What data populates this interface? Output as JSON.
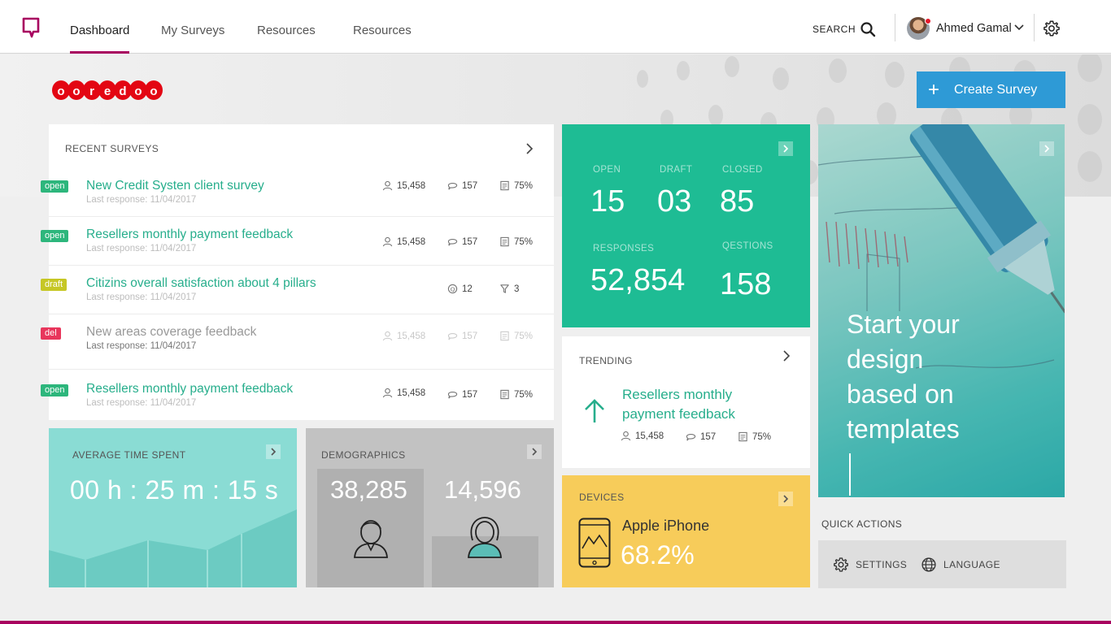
{
  "nav": {
    "tabs": [
      {
        "label": "Dashboard"
      },
      {
        "label": "My Surveys"
      },
      {
        "label": "Resources"
      },
      {
        "label": "Resources"
      }
    ],
    "search_label": "SEARCH",
    "user_name": "Ahmed Gamal"
  },
  "brand": {
    "letters": [
      "o",
      "o",
      "r",
      "e",
      "d",
      "o",
      "o"
    ]
  },
  "create_button": {
    "label": "Create Survey"
  },
  "recent": {
    "title": "RECENT SURVEYS",
    "rows": [
      {
        "status": "open",
        "title": "New Credit Systen client survey",
        "sub": "Last response: 11/04/2017",
        "users": "15,458",
        "comments": "157",
        "pct": "75%"
      },
      {
        "status": "open",
        "title": "Resellers monthly payment feedback",
        "sub": "Last response: 11/04/2017",
        "users": "15,458",
        "comments": "157",
        "pct": "75%"
      },
      {
        "status": "draft",
        "title": "Citizins overall satisfaction about 4 pillars",
        "sub": "Last response: 11/04/2017",
        "questions": "12",
        "filters": "3"
      },
      {
        "status": "del",
        "title": "New areas coverage feedback",
        "sub": "Last response: 11/04/2017",
        "users": "15,458",
        "comments": "157",
        "pct": "75%"
      },
      {
        "status": "open",
        "title": "Resellers monthly payment feedback",
        "sub": "Last response: 11/04/2017",
        "users": "15,458",
        "comments": "157",
        "pct": "75%"
      }
    ]
  },
  "stats": {
    "open_label": "OPEN",
    "open": "15",
    "draft_label": "DRAFT",
    "draft": "03",
    "closed_label": "CLOSED",
    "closed": "85",
    "responses_label": "RESPONSES",
    "responses": "52,854",
    "questions_label": "QESTIONS",
    "questions": "158"
  },
  "template_card": {
    "line1": "Start your",
    "line2": "design",
    "line3": "based on",
    "line4": "templates"
  },
  "trending": {
    "title": "TRENDING",
    "survey_line1": "Resellers monthly",
    "survey_line2": "payment feedback",
    "users": "15,458",
    "comments": "157",
    "pct": "75%"
  },
  "devices": {
    "title": "DEVICES",
    "name": "Apple iPhone",
    "pct": "68.2%"
  },
  "average_time": {
    "title": "AVERAGE TIME SPENT",
    "value": "00 h : 25 m : 15 s"
  },
  "demographics": {
    "title": "DEMOGRAPHICS",
    "male": "38,285",
    "female": "14,596"
  },
  "quick_actions": {
    "title": "QUICK ACTIONS",
    "settings": "SETTINGS",
    "language": "LANGUAGE"
  },
  "colors": {
    "brand": "#a8005f",
    "accent_green": "#1ebc94",
    "button_blue": "#2e9ad6",
    "devices_yellow": "#f7cc5a"
  }
}
